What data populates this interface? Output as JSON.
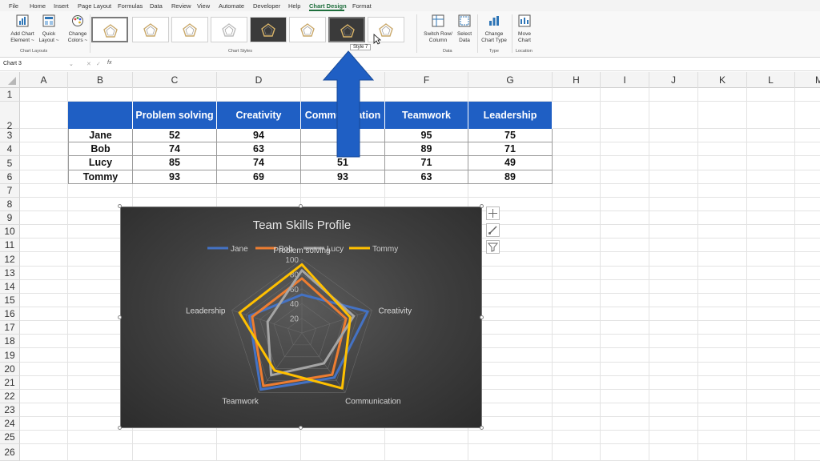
{
  "menu": [
    "File",
    "Home",
    "Insert",
    "Page Layout",
    "Formulas",
    "Data",
    "Review",
    "View",
    "Automate",
    "Developer",
    "Help",
    "Chart Design",
    "Format"
  ],
  "ribbon": {
    "add_chart_element": [
      "Add Chart",
      "Element ~"
    ],
    "quick_layout": [
      "Quick",
      "Layout ~"
    ],
    "change_colors": [
      "Change",
      "Colors ~"
    ],
    "chart_layouts_label": "Chart Layouts",
    "chart_styles_label": "Chart Styles",
    "switch_row_column": [
      "Switch Row/",
      "Column"
    ],
    "select_data": [
      "Select",
      "Data"
    ],
    "data_label": "Data",
    "change_chart_type": [
      "Change",
      "Chart Type"
    ],
    "type_label": "Type",
    "move_chart": [
      "Move",
      "Chart"
    ],
    "location_label": "Location",
    "tooltip": "Style 7"
  },
  "formula_bar": {
    "name_box": "Chart 3",
    "fx": "fx"
  },
  "columns": [
    "A",
    "B",
    "C",
    "D",
    "E",
    "F",
    "G",
    "H",
    "I",
    "J",
    "K",
    "L",
    "M"
  ],
  "rows": [
    "1",
    "2",
    "3",
    "4",
    "5",
    "6",
    "7",
    "8",
    "9",
    "10",
    "11",
    "12",
    "13",
    "14",
    "15",
    "16",
    "17",
    "18",
    "19",
    "20",
    "21",
    "22",
    "23",
    "24",
    "25",
    "26"
  ],
  "table": {
    "headers": [
      "",
      "Problem solving",
      "Creativity",
      "Communication",
      "Teamwork",
      "Leadership"
    ],
    "rows": [
      [
        "Jane",
        "52",
        "94",
        "",
        "95",
        "75"
      ],
      [
        "Bob",
        "74",
        "63",
        "",
        "89",
        "71"
      ],
      [
        "Lucy",
        "85",
        "74",
        "51",
        "71",
        "49"
      ],
      [
        "Tommy",
        "93",
        "69",
        "93",
        "63",
        "89"
      ]
    ]
  },
  "colors": {
    "header_blue": "#1f5fc4",
    "arrow_blue": "#1f5fc4",
    "accent_green": "#1e6e3c"
  },
  "chart_data": {
    "type": "radar",
    "title": "Team Skills Profile",
    "categories": [
      "Problem solving",
      "Creativity",
      "Communication",
      "Teamwork",
      "Leadership"
    ],
    "rmax": 100,
    "ticks": [
      "20",
      "40",
      "60",
      "80",
      "100"
    ],
    "legend_position": "top",
    "series": [
      {
        "name": "Jane",
        "color": "#4472c4",
        "values": [
          52,
          94,
          75,
          95,
          75
        ]
      },
      {
        "name": "Bob",
        "color": "#ed7d31",
        "values": [
          74,
          63,
          70,
          89,
          71
        ]
      },
      {
        "name": "Lucy",
        "color": "#a5a5a5",
        "values": [
          85,
          74,
          51,
          71,
          49
        ]
      },
      {
        "name": "Tommy",
        "color": "#ffc000",
        "values": [
          93,
          69,
          93,
          63,
          89
        ]
      }
    ]
  }
}
